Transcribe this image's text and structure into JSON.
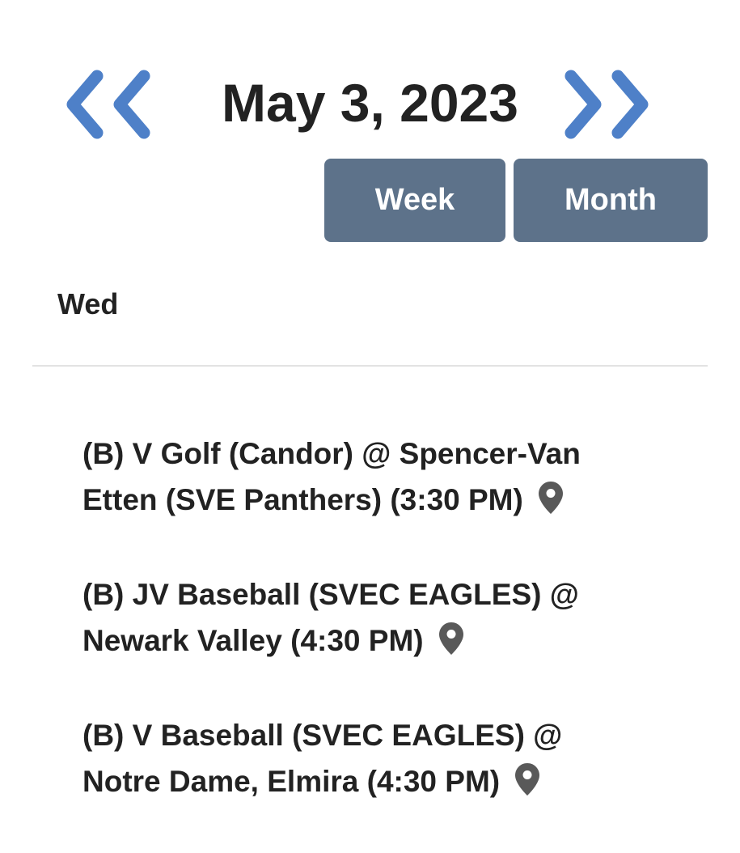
{
  "header": {
    "date": "May 3, 2023",
    "prev_icon": "double-chevron-left-icon",
    "next_icon": "double-chevron-right-icon",
    "arrow_color": "#4e80c8"
  },
  "views": {
    "week_label": "Week",
    "month_label": "Month",
    "button_color": "#5d728a"
  },
  "day": {
    "label": "Wed"
  },
  "events": [
    {
      "text": "(B) V Golf (Candor) @ Spencer-Van Etten (SVE Panthers) (3:30 PM)",
      "icon": "map-pin-icon"
    },
    {
      "text": "(B) JV Baseball (SVEC EAGLES) @ Newark Valley (4:30 PM)",
      "icon": "map-pin-icon"
    },
    {
      "text": "(B) V Baseball (SVEC EAGLES) @ Notre Dame, Elmira (4:30 PM)",
      "icon": "map-pin-icon"
    }
  ]
}
